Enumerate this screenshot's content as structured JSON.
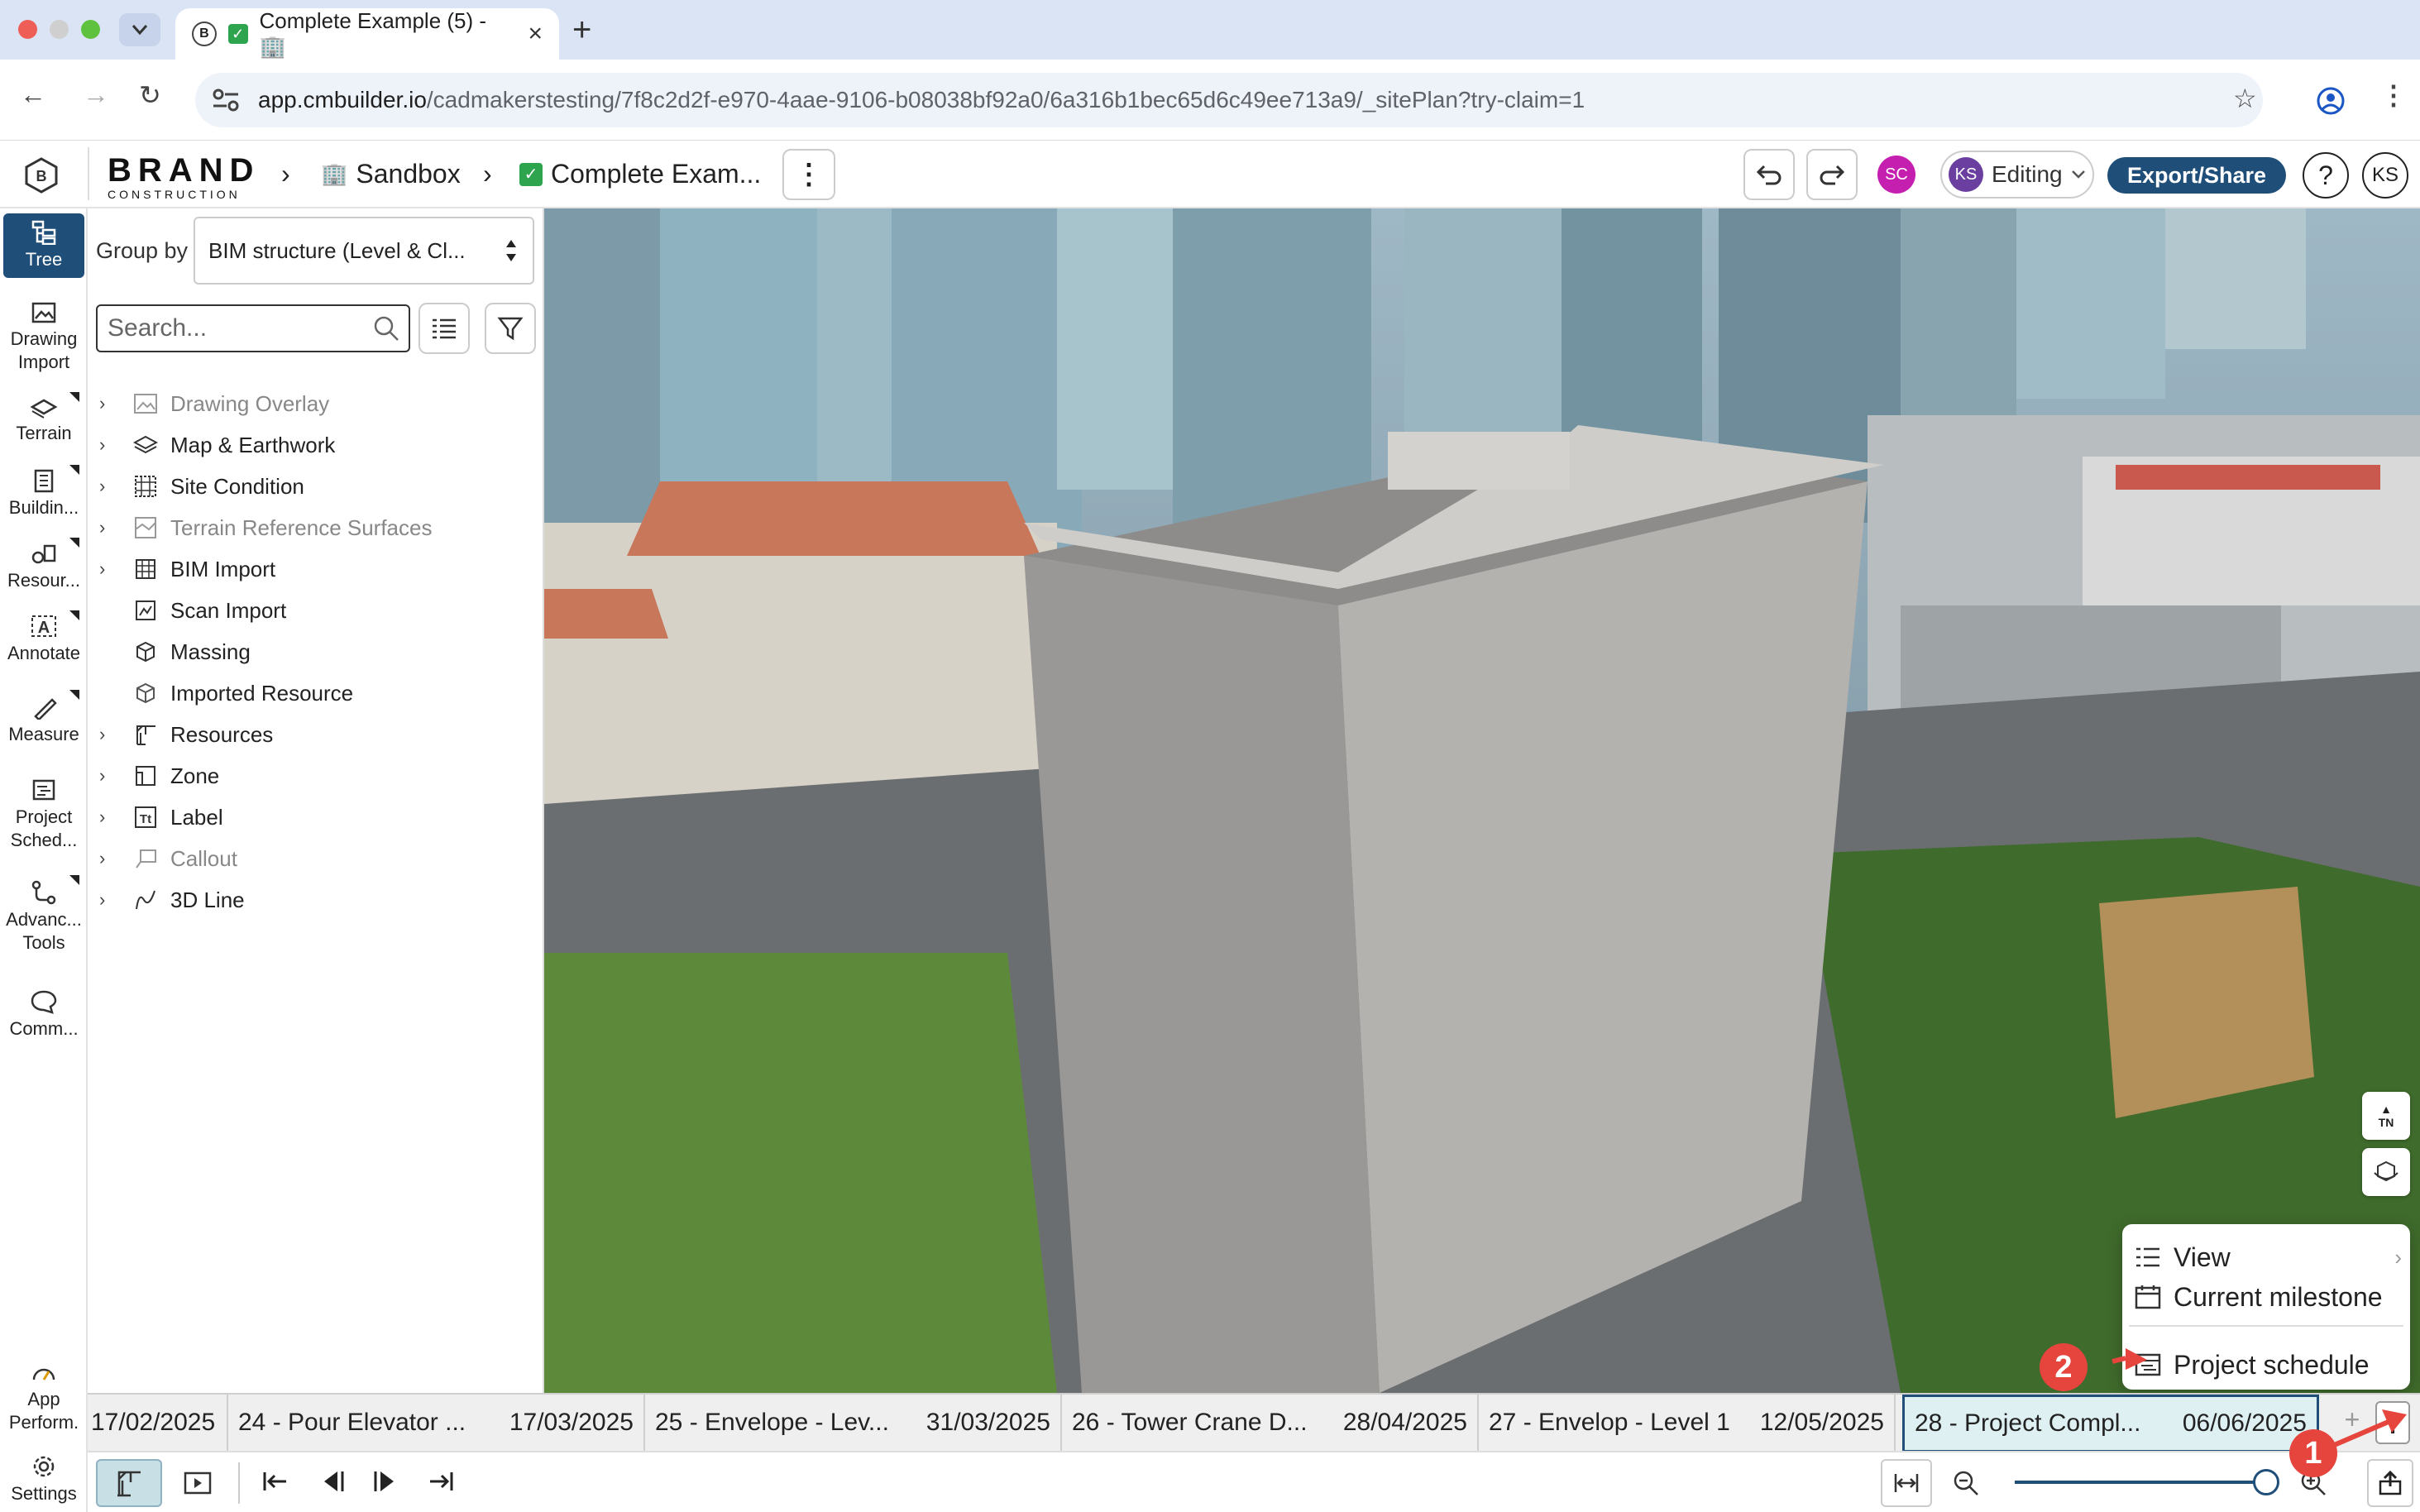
{
  "browser": {
    "tab_title": "Complete Example (5) - 🏢",
    "url_host": "app.cmbuilder.io",
    "url_path": "/cadmakerstesting/7f8c2d2f-e970-4aae-9106-b08038bf92a0/6a316b1bec65d6c49ee713a9/_sitePlan?try-claim=1"
  },
  "appbar": {
    "brand_line1": "BRAND",
    "brand_line2": "CONSTRUCTION",
    "crumb_sandbox": "Sandbox",
    "crumb_project": "Complete Exam...",
    "user_sc": "SC",
    "user_ks": "KS",
    "mode": "Editing",
    "export_label": "Export/Share",
    "help": "?",
    "avatar": "KS"
  },
  "rail": [
    {
      "label1": "Tree",
      "label2": ""
    },
    {
      "label1": "Drawing",
      "label2": "Import"
    },
    {
      "label1": "Terrain",
      "label2": ""
    },
    {
      "label1": "Buildin...",
      "label2": ""
    },
    {
      "label1": "Resour...",
      "label2": ""
    },
    {
      "label1": "Annotate",
      "label2": ""
    },
    {
      "label1": "Measure",
      "label2": ""
    },
    {
      "label1": "Project",
      "label2": "Sched..."
    },
    {
      "label1": "Advanc...",
      "label2": "Tools"
    },
    {
      "label1": "Comm...",
      "label2": ""
    },
    {
      "label1": "App",
      "label2": "Perform."
    },
    {
      "label1": "Settings",
      "label2": ""
    }
  ],
  "panel": {
    "group_by_label": "Group by",
    "group_by_value": "BIM structure (Level & Cl...",
    "search_placeholder": "Search...",
    "tree": [
      {
        "label": "Drawing Overlay",
        "muted": true
      },
      {
        "label": "Map & Earthwork",
        "muted": false
      },
      {
        "label": "Site Condition",
        "muted": false
      },
      {
        "label": "Terrain Reference Surfaces",
        "muted": true
      },
      {
        "label": "BIM Import",
        "muted": false
      },
      {
        "label": "Scan Import",
        "muted": false
      },
      {
        "label": "Massing",
        "muted": false
      },
      {
        "label": "Imported Resource",
        "muted": false
      },
      {
        "label": "Resources",
        "muted": false
      },
      {
        "label": "Zone",
        "muted": false
      },
      {
        "label": "Label",
        "muted": false
      },
      {
        "label": "Callout",
        "muted": true
      },
      {
        "label": "3D Line",
        "muted": false
      }
    ]
  },
  "timeline": {
    "milestones": [
      {
        "name": "",
        "date": "17/02/2025"
      },
      {
        "name": "24 - Pour Elevator ...",
        "date": "17/03/2025"
      },
      {
        "name": "25 - Envelope - Lev...",
        "date": "31/03/2025"
      },
      {
        "name": "26 - Tower Crane D...",
        "date": "28/04/2025"
      },
      {
        "name": "27 - Envelop - Level 1",
        "date": "12/05/2025"
      },
      {
        "name": "28 - Project Compl...",
        "date": "06/06/2025"
      }
    ]
  },
  "menu": {
    "view": "View",
    "current_milestone": "Current milestone",
    "project_schedule": "Project schedule"
  },
  "badges": {
    "one": "1",
    "two": "2"
  },
  "compass": "TN",
  "colors": {
    "accent": "#1f4e79",
    "rail_active": "#1f4e79",
    "purple": "#6b3fa0",
    "pink": "#c51fb0",
    "badge": "#e5453d"
  }
}
